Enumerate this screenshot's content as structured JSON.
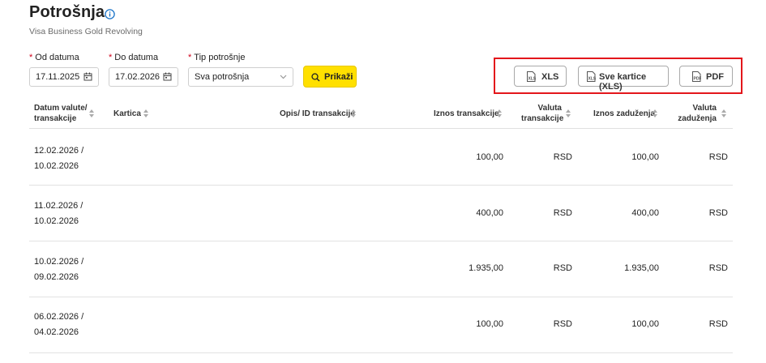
{
  "page": {
    "title": "Potrošnja",
    "subtitle": "Visa Business Gold Revolving"
  },
  "filters": {
    "from": {
      "label": "Od datuma",
      "value": "17.11.2025"
    },
    "to": {
      "label": "Do datuma",
      "value": "17.02.2026"
    },
    "type": {
      "label": "Tip potrošnje",
      "value": "Sva potrošnja"
    },
    "show_label": "Prikaži"
  },
  "export": {
    "xls_label": "XLS",
    "all_cards_label": "Sve kartice (XLS)",
    "pdf_label": "PDF",
    "highlight_color": "#e3161b"
  },
  "table": {
    "headers": {
      "date_line1": "Datum valute/",
      "date_line2": "transakcije",
      "card": "Kartica",
      "desc": "Opis/ ID transakcije",
      "amount": "Iznos transakcije",
      "currency_line1": "Valuta",
      "currency_line2": "transakcije",
      "charge": "Iznos zaduženja",
      "charge_currency_line1": "Valuta",
      "charge_currency_line2": "zaduženja"
    },
    "rows": [
      {
        "value_date": "12.02.2026 /",
        "tx_date": "10.02.2026",
        "amount": "100,00",
        "currency": "RSD",
        "charge": "100,00",
        "charge_currency": "RSD"
      },
      {
        "value_date": "11.02.2026 /",
        "tx_date": "10.02.2026",
        "amount": "400,00",
        "currency": "RSD",
        "charge": "400,00",
        "charge_currency": "RSD"
      },
      {
        "value_date": "10.02.2026 /",
        "tx_date": "09.02.2026",
        "amount": "1.935,00",
        "currency": "RSD",
        "charge": "1.935,00",
        "charge_currency": "RSD"
      },
      {
        "value_date": "06.02.2026 /",
        "tx_date": "04.02.2026",
        "amount": "100,00",
        "currency": "RSD",
        "charge": "100,00",
        "charge_currency": "RSD"
      }
    ]
  },
  "colors": {
    "accent": "#ffe000",
    "info_icon": "#1a73c8"
  }
}
